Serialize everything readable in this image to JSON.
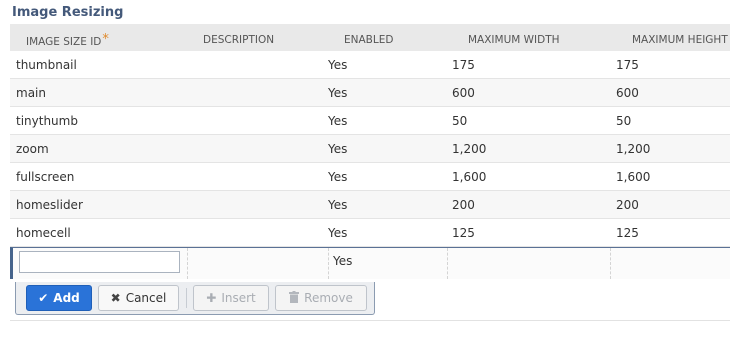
{
  "section": {
    "title": "Image Resizing"
  },
  "grid": {
    "headers": {
      "id": "IMAGE SIZE ID",
      "required_mark": "*",
      "description": "DESCRIPTION",
      "enabled": "ENABLED",
      "max_width": "MAXIMUM WIDTH",
      "max_height": "MAXIMUM HEIGHT"
    },
    "rows": [
      {
        "id": "thumbnail",
        "description": "",
        "enabled": "Yes",
        "max_width": "175",
        "max_height": "175"
      },
      {
        "id": "main",
        "description": "",
        "enabled": "Yes",
        "max_width": "600",
        "max_height": "600"
      },
      {
        "id": "tinythumb",
        "description": "",
        "enabled": "Yes",
        "max_width": "50",
        "max_height": "50"
      },
      {
        "id": "zoom",
        "description": "",
        "enabled": "Yes",
        "max_width": "1,200",
        "max_height": "1,200"
      },
      {
        "id": "fullscreen",
        "description": "",
        "enabled": "Yes",
        "max_width": "1,600",
        "max_height": "1,600"
      },
      {
        "id": "homeslider",
        "description": "",
        "enabled": "Yes",
        "max_width": "200",
        "max_height": "200"
      },
      {
        "id": "homecell",
        "description": "",
        "enabled": "Yes",
        "max_width": "125",
        "max_height": "125"
      }
    ],
    "edit_row": {
      "id_value": "",
      "enabled": "Yes"
    }
  },
  "buttons": {
    "add": "Add",
    "cancel": "Cancel",
    "insert": "Insert",
    "remove": "Remove"
  },
  "icons": {
    "add": "check-icon",
    "cancel": "close-icon",
    "insert": "plus-icon",
    "remove": "trash-icon"
  },
  "colors": {
    "title": "#44597a",
    "primary_button": "#2a73d8",
    "required": "#e08a2c"
  }
}
